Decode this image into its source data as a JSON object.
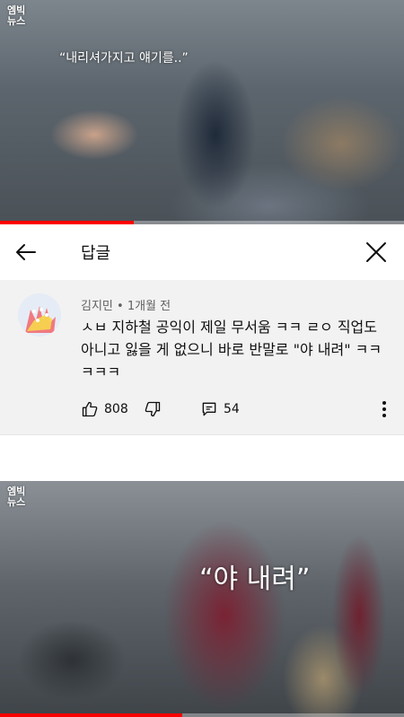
{
  "video_top": {
    "channel_logo": "엠빅\n뉴스",
    "subtitle": "“내리셔가지고 얘기를..”",
    "progress": 0.33
  },
  "reply_header": {
    "title": "답글",
    "back_icon": "arrow-left-icon",
    "close_icon": "close-icon"
  },
  "comment": {
    "author": "김지민",
    "time": "1개월 전",
    "meta_separator": " • ",
    "text": "ㅅㅂ 지하철 공익이 제일 무서움 ㅋㅋ ㄹㅇ 직업도 아니고 잃을 게 없으니 바로 반말로 \"야 내려\" ㅋㅋㅋㅋㅋ",
    "likes": "808",
    "replies": "54",
    "icons": [
      "thumb-up-icon",
      "thumb-down-icon",
      "reply-icon",
      "more-vertical-icon"
    ]
  },
  "video_bottom": {
    "channel_logo": "엠빅\n뉴스",
    "subtitle": "“야 내려”",
    "progress": 0.45
  },
  "colors": {
    "progress_red": "#ff0000",
    "text": "#0f0f0f",
    "meta": "#606060",
    "comment_bg": "#f2f2f2"
  }
}
